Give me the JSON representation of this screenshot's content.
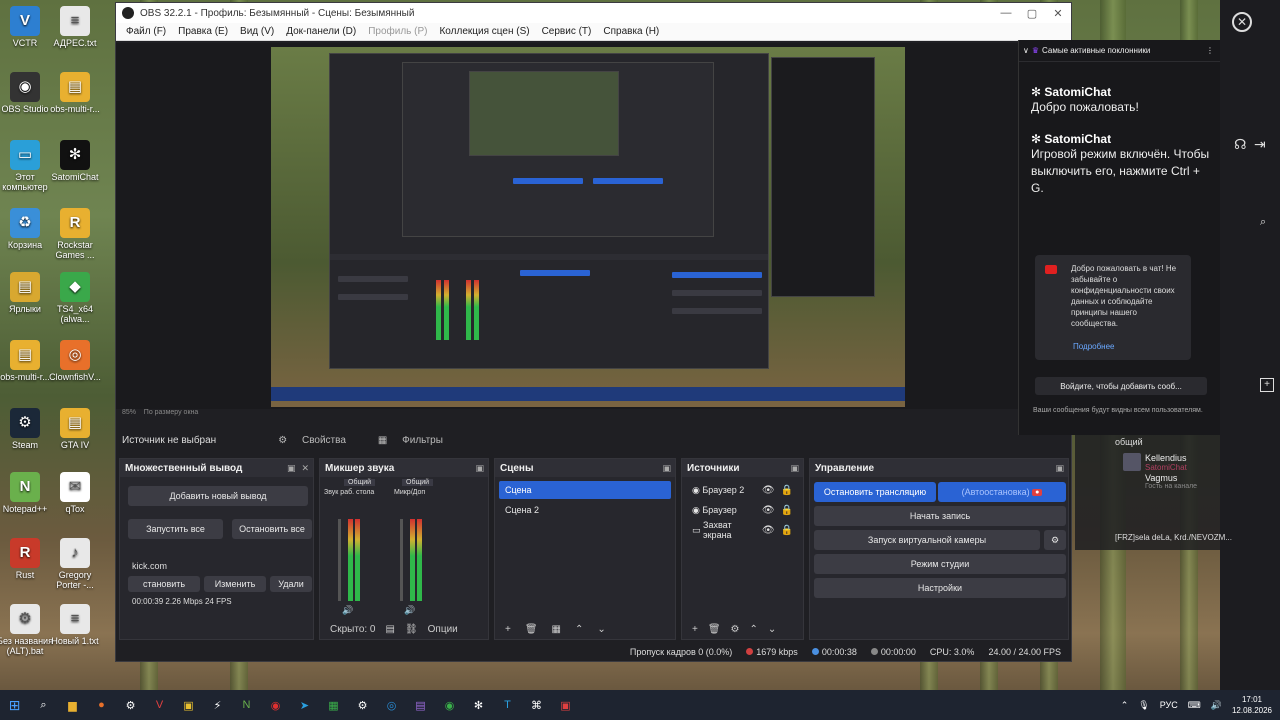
{
  "desktop": {
    "icons": [
      {
        "label": "VCTR",
        "color": "#2d7fd1",
        "glyph": "V"
      },
      {
        "label": "АДРЕС.txt",
        "color": "#e8e8e8",
        "glyph": "≡"
      },
      {
        "label": "OBS Studio",
        "color": "#333333",
        "glyph": "◉"
      },
      {
        "label": "obs-multi-r...",
        "color": "#e8b030",
        "glyph": "▤"
      },
      {
        "label": "Этот компьютер",
        "color": "#2a9fd8",
        "glyph": "▭"
      },
      {
        "label": "SatomiChat",
        "color": "#111111",
        "glyph": "✻"
      },
      {
        "label": "Корзина",
        "color": "#3a8fd8",
        "glyph": "♻"
      },
      {
        "label": "Rockstar Games ...",
        "color": "#e8b030",
        "glyph": "R"
      },
      {
        "label": "Ярлыки",
        "color": "#d8a830",
        "glyph": "▤"
      },
      {
        "label": "TS4_x64 (alwa...",
        "color": "#3aa84a",
        "glyph": "◆"
      },
      {
        "label": "obs-multi-r...",
        "color": "#e8b030",
        "glyph": "▤"
      },
      {
        "label": "ClownfishV...",
        "color": "#e8702a",
        "glyph": "◎"
      },
      {
        "label": "Steam",
        "color": "#1b2838",
        "glyph": "⚙"
      },
      {
        "label": "GTA IV",
        "color": "#e8b030",
        "glyph": "▤"
      },
      {
        "label": "Notepad++",
        "color": "#6ab04c",
        "glyph": "N"
      },
      {
        "label": "qTox",
        "color": "#ffffff",
        "glyph": "✉"
      },
      {
        "label": "Rust",
        "color": "#c83a2a",
        "glyph": "R"
      },
      {
        "label": "Gregory Porter -...",
        "color": "#e8e8e8",
        "glyph": "♪"
      },
      {
        "label": "Без названия (ALT).bat",
        "color": "#e8e8e8",
        "glyph": "⚙"
      },
      {
        "label": "Новый 1.txt",
        "color": "#e8e8e8",
        "glyph": "≡"
      }
    ]
  },
  "obs": {
    "title": "OBS 32.2.1 - Профиль: Безымянный - Сцены: Безымянный",
    "menu": [
      "Файл (F)",
      "Правка (E)",
      "Вид (V)",
      "Док-панели (D)",
      "Профиль (P)",
      "Коллекция сцен (S)",
      "Сервис (T)",
      "Справка (H)"
    ],
    "zoom_label": "85%",
    "zoom_mode": "По размеру окна",
    "source_status": "Источник не выбран",
    "properties_label": "Свойства",
    "filters_label": "Фильтры",
    "multi_output": {
      "title": "Множественный вывод",
      "add_button": "Добавить новый вывод",
      "start_all": "Запустить все",
      "stop_all": "Остановить все",
      "target_name": "kick.com",
      "stop": "становить",
      "edit": "Изменить",
      "delete": "Удали",
      "stats": "00:00:39 2.26 Mbps 24 FPS"
    },
    "mixer": {
      "title": "Микшер звука",
      "channel1_tag": "Общий",
      "channel1_name": "Звук раб. стола",
      "channel2_tag": "Общий",
      "channel2_name": "Микр/Доп",
      "hidden": "Скрыто: 0",
      "options": "Опции"
    },
    "scenes": {
      "title": "Сцены",
      "items": [
        "Сцена",
        "Сцена 2"
      ],
      "selected": 0
    },
    "sources": {
      "title": "Источники",
      "items": [
        {
          "icon": "◉",
          "name": "Браузер 2"
        },
        {
          "icon": "◉",
          "name": "Браузер"
        },
        {
          "icon": "▭",
          "name": "Захват экрана"
        }
      ]
    },
    "controls": {
      "title": "Управление",
      "stop_stream": "Остановить трансляцию",
      "auto_stop": "(Автоостановка)",
      "start_record": "Начать запись",
      "virtual_cam": "Запуск виртуальной камеры",
      "studio_mode": "Режим студии",
      "settings": "Настройки"
    },
    "status": {
      "dropped": "Пропуск кадров 0 (0.0%)",
      "bitrate": "1679 kbps",
      "stream_time": "00:00:38",
      "record_time": "00:00:00",
      "cpu": "CPU: 3.0%",
      "fps": "24.00 / 24.00 FPS"
    }
  },
  "chat": {
    "header": "Самые активные поклонники",
    "messages": [
      {
        "name": "SatomiChat",
        "text": "Добро пожаловать!"
      },
      {
        "name": "SatomiChat",
        "text": "Игровой режим включён. Чтобы выключить его, нажмите Ctrl + G."
      }
    ],
    "notice": "Добро пожаловать в чат! Не забывайте о конфиденциальности своих данных и соблюдайте принципы нашего сообщества.",
    "notice_more": "Подробнее",
    "login": "Войдите, чтобы добавить сооб...",
    "footer": "Ваши сообщения будут видны всем пользователям."
  },
  "side_panel": {
    "channel": "общий",
    "user1": "Kellendius",
    "user1_sub": "SatomiChat",
    "user2": "Vagmus",
    "user2_sub": "Гость на канале",
    "bottom_item": "[FRZ]sela deLa, Krd./NEVOZM..."
  },
  "taskbar": {
    "lang": "РУС",
    "time": "17:01",
    "date": "12.08.2026"
  }
}
